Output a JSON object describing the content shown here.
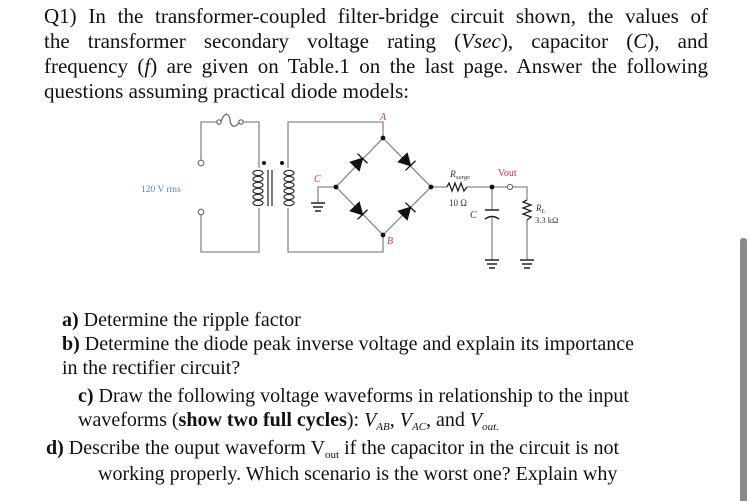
{
  "intro": {
    "line1": "Q1) In the transformer-coupled filter-bridge circuit shown, the values of",
    "line2_a": "the transformer secondary voltage rating (",
    "line2_vsec": "Vsec",
    "line2_b": "), capacitor (",
    "line2_c": "C",
    "line2_d": "), and",
    "line3_a": "frequency (",
    "line3_f": "f",
    "line3_b": ") are given on Table.1 on the last page. Answer the following",
    "line4": "questions assuming practical diode models:"
  },
  "circuit": {
    "source_label": "120 V rms",
    "node_a": "A",
    "node_b": "B",
    "node_c": "C",
    "rsurge_label": "R",
    "rsurge_sub": "surge",
    "rsurge_value": "10 Ω",
    "cap_label": "C",
    "vout_label": "Vout",
    "rl_label": "R",
    "rl_sub": "L",
    "rl_value": "3.3 kΩ",
    "colors": {
      "wire": "#8a8a8a",
      "node_label": "#c0337a",
      "source_label": "#4a90c8",
      "vout_label": "#c0334a"
    }
  },
  "questions": {
    "a_tag": "a)",
    "a_text": " Determine the ripple factor",
    "b_tag": "b)",
    "b_text": " Determine the diode peak inverse voltage and explain its importance",
    "b_text2": "in the rectifier circuit?",
    "c_tag": "c)",
    "c_text": " Draw the following voltage waveforms in relationship to the input",
    "c_line2_a": "waveforms (",
    "c_line2_bold": "show two full cycles",
    "c_line2_b": "): ",
    "c_v1": "V",
    "c_v1_sub": "AB",
    "c_sep1": ", ",
    "c_v2": "V",
    "c_v2_sub": "AC",
    "c_sep2": ", and ",
    "c_v3": "V",
    "c_v3_sub": "out.",
    "d_tag": "d)",
    "d_text_a": " Describe the ouput waveform V",
    "d_sub": "out",
    "d_text_b": " if the capacitor in the circuit is not",
    "d_text2": "working properly. Which scenario is the worst one? Explain why"
  }
}
